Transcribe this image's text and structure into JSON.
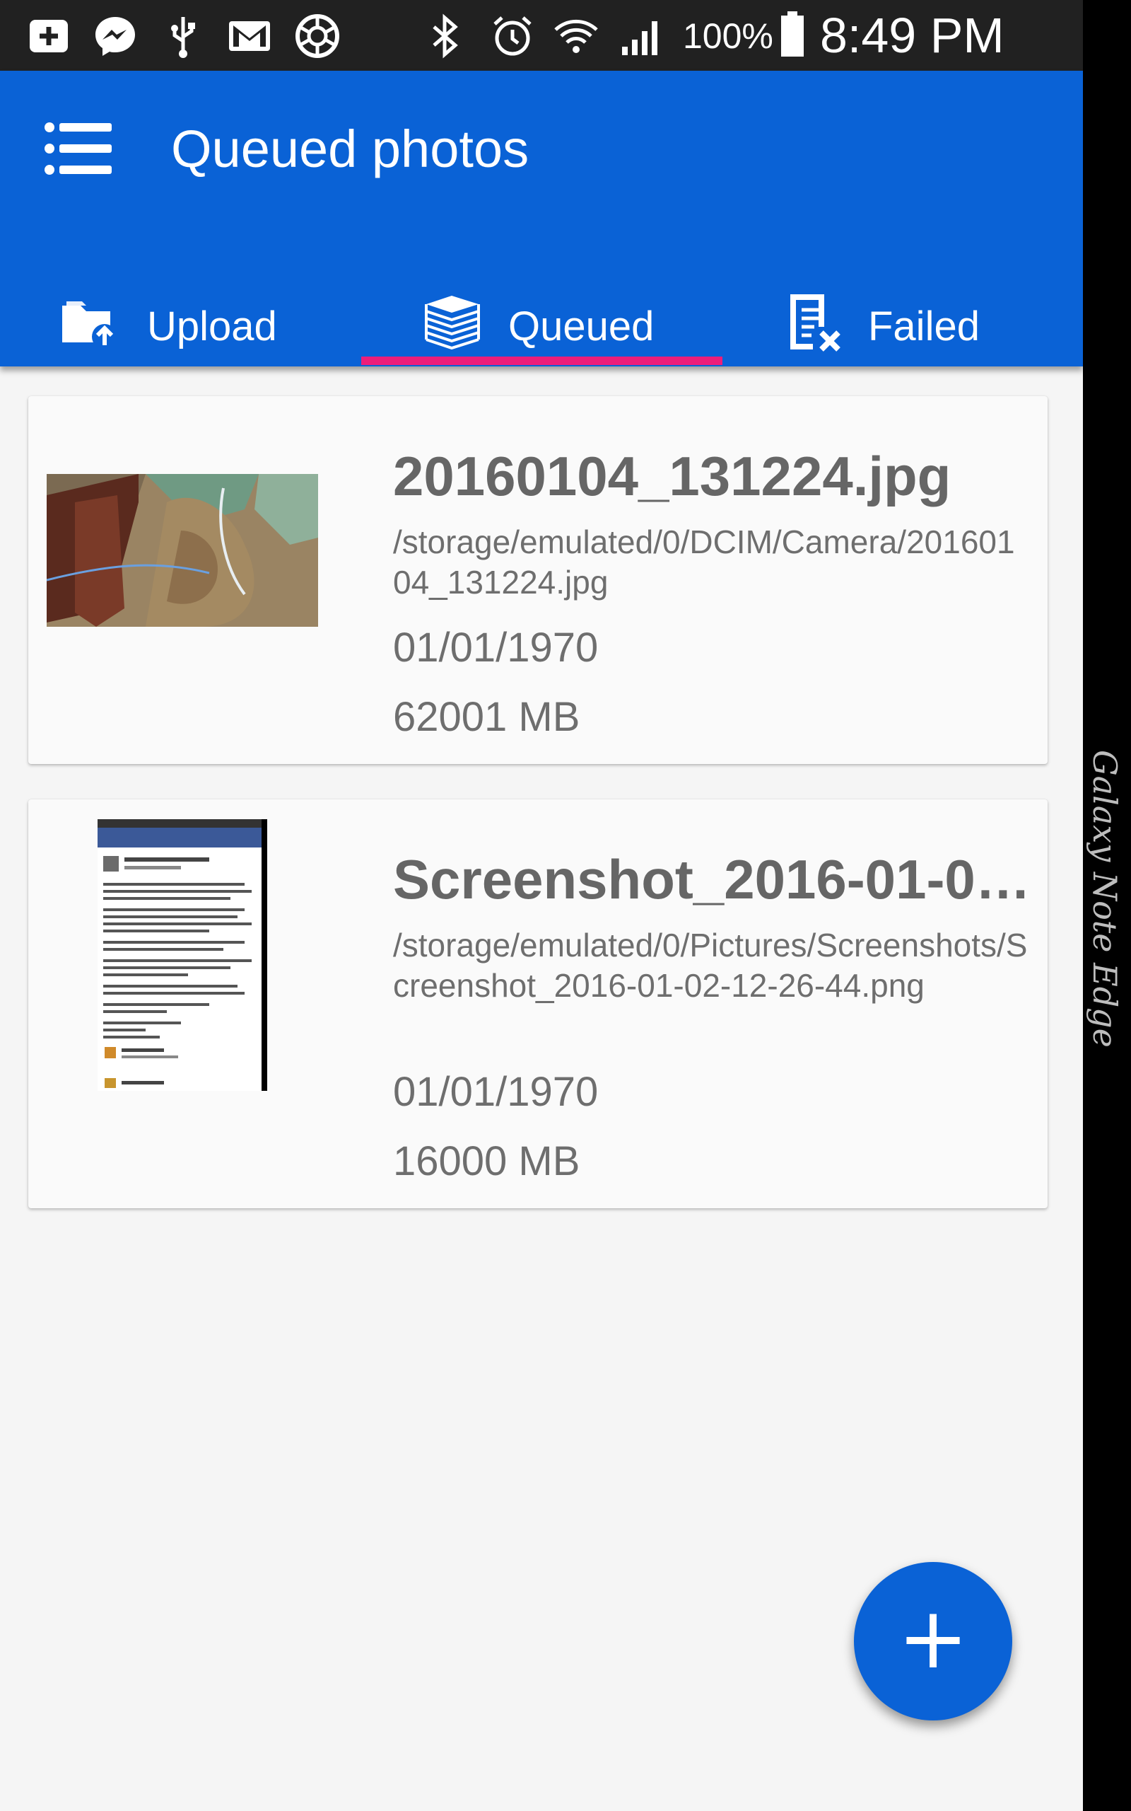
{
  "status_bar": {
    "icons": [
      "plus-box-icon",
      "messenger-icon",
      "usb-icon",
      "gmail-icon",
      "aperture-icon",
      "bluetooth-icon",
      "alarm-icon",
      "wifi-icon",
      "signal-icon",
      "battery-icon"
    ],
    "battery": "100%",
    "time": "8:49 PM"
  },
  "app_bar": {
    "title": "Queued photos",
    "menu_icon": "list-menu-icon"
  },
  "tabs": [
    {
      "label": "Upload",
      "icon": "folder-upload-icon"
    },
    {
      "label": "Queued",
      "icon": "stack-icon",
      "selected": true
    },
    {
      "label": "Failed",
      "icon": "document-x-icon"
    }
  ],
  "queue": [
    {
      "name": "20160104_131224.jpg",
      "path": "/storage/emulated/0/DCIM/Camera/20160104_131224.jpg",
      "date": "01/01/1970",
      "size": "62001 MB"
    },
    {
      "name": "Screenshot_2016-01-02-12-26-44.png",
      "path": "/storage/emulated/0/Pictures/Screenshots/Screenshot_2016-01-02-12-26-44.png",
      "date": "01/01/1970",
      "size": "16000 MB"
    }
  ],
  "fab": {
    "label": "+"
  },
  "device_edge": {
    "label": "Galaxy Note Edge"
  },
  "colors": {
    "primary": "#0a62d6",
    "accent": "#ec1e7a",
    "status_bar": "#212121",
    "background": "#f5f5f5",
    "text_secondary": "#6e6e6e"
  }
}
